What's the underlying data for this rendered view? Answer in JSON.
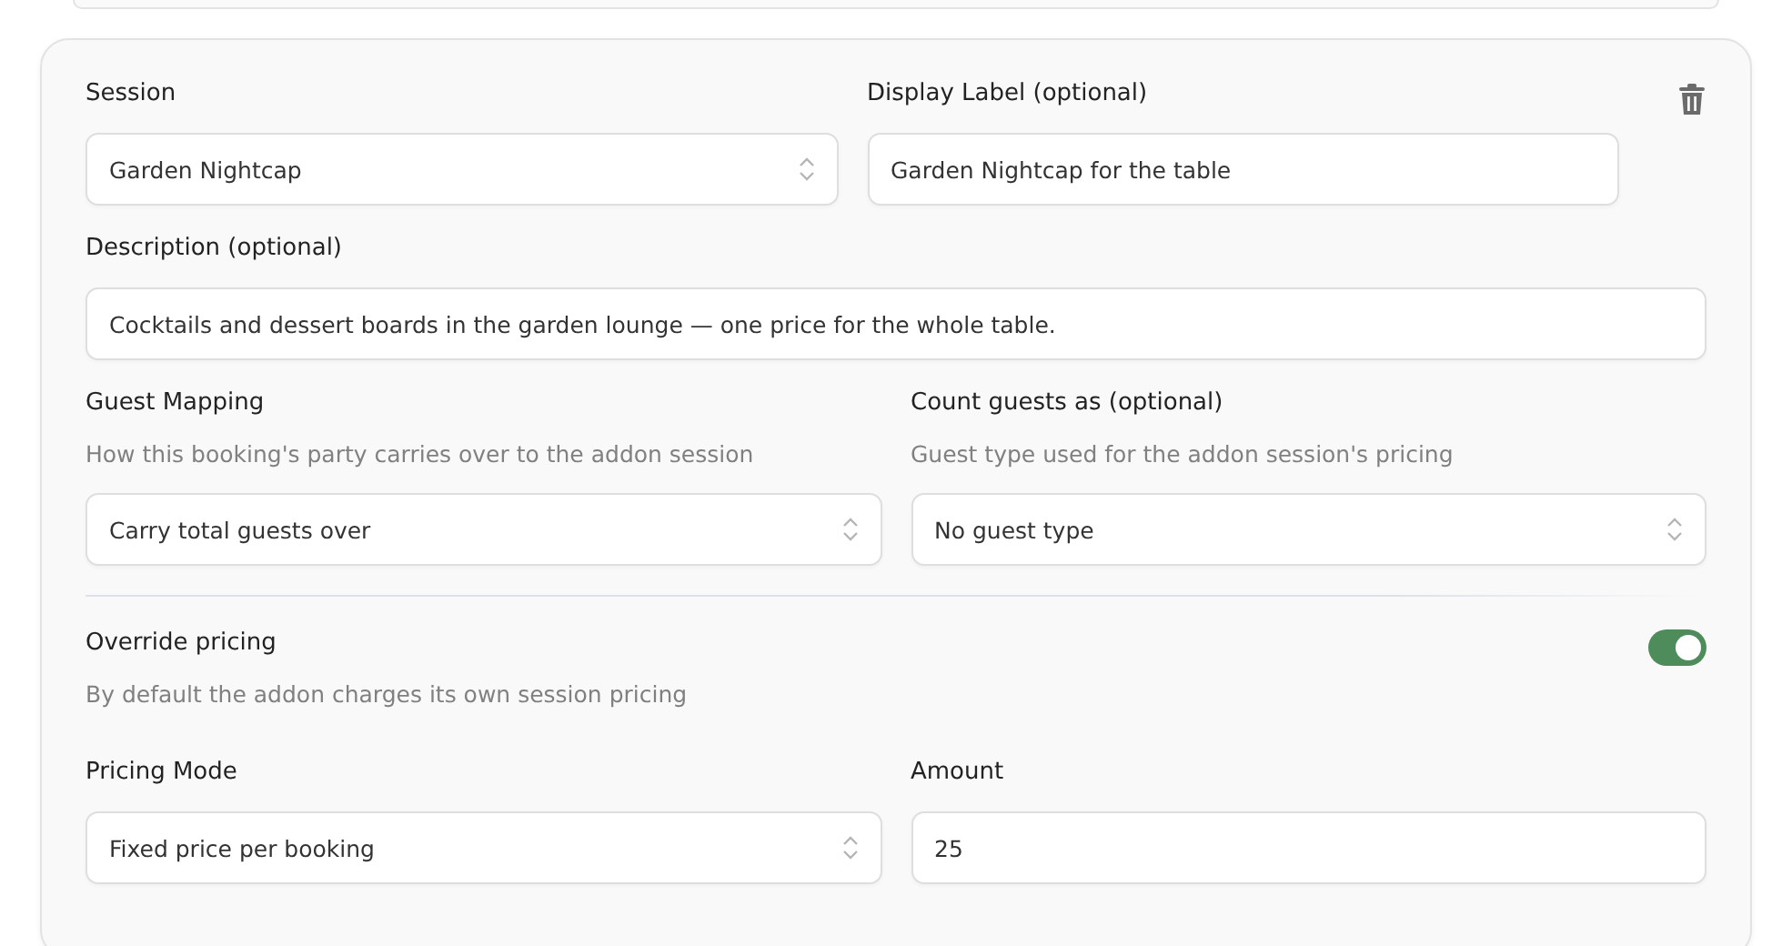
{
  "session": {
    "label": "Session",
    "value": "Garden Nightcap"
  },
  "display_label": {
    "label": "Display Label (optional)",
    "value": "Garden Nightcap for the table"
  },
  "description": {
    "label": "Description (optional)",
    "value": "Cocktails and dessert boards in the garden lounge — one price for the whole table."
  },
  "guest_mapping": {
    "label": "Guest Mapping",
    "hint": "How this booking's party carries over to the addon session",
    "value": "Carry total guests over"
  },
  "count_guests_as": {
    "label": "Count guests as (optional)",
    "hint": "Guest type used for the addon session's pricing",
    "value": "No guest type"
  },
  "override_pricing": {
    "label": "Override pricing",
    "hint": "By default the addon charges its own session pricing",
    "on": true
  },
  "pricing_mode": {
    "label": "Pricing Mode",
    "value": "Fixed price per booking"
  },
  "amount": {
    "label": "Amount",
    "value": "25"
  }
}
